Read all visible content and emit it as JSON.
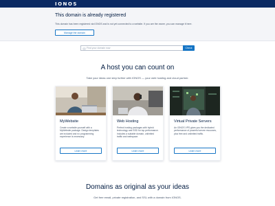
{
  "header": {
    "logo_text": "IONOS"
  },
  "notice": {
    "title": "This domain is already registered",
    "text": "This domain has been registered via IONOS and is not yet connected to a website. If you are the owner, you can manage it here.",
    "button_label": "Manage the domain"
  },
  "search": {
    "placeholder": "Find your domain now",
    "button_label": "Check"
  },
  "hosting": {
    "heading": "A host you can count on",
    "subheading": "Take your ideas one step further with IONOS — your web hosting and cloud partner.",
    "cards": [
      {
        "title": "MyWebsite",
        "text": "Create a website yourself with a MyWebsite package. Design templates are included and no programming experience is necessary.",
        "button_label": "Learn more",
        "image": "person-at-laptop-photo"
      },
      {
        "title": "Web Hosting",
        "text": "Perfect hosting packages with hybrid technology and SSD for top performance. Includes a suitable domain, unlimited traffic and webspace.",
        "button_label": "Learn more",
        "image": "person-on-phone-photo"
      },
      {
        "title": "Virtual Private Servers",
        "text": "An IONOS VPS gives you the dedicated performance of powerful server resources, plus free and unlimited traffic.",
        "button_label": "Learn more",
        "image": "data-center-photo"
      }
    ]
  },
  "domains": {
    "heading": "Domains as original as your ideas",
    "subheading": "Get free email, private registration, and SSL with a domain from IONOS."
  },
  "colors": {
    "brand": "#0b2a63",
    "accent": "#1474c4",
    "text": "#001b41",
    "muted": "#46556b"
  }
}
